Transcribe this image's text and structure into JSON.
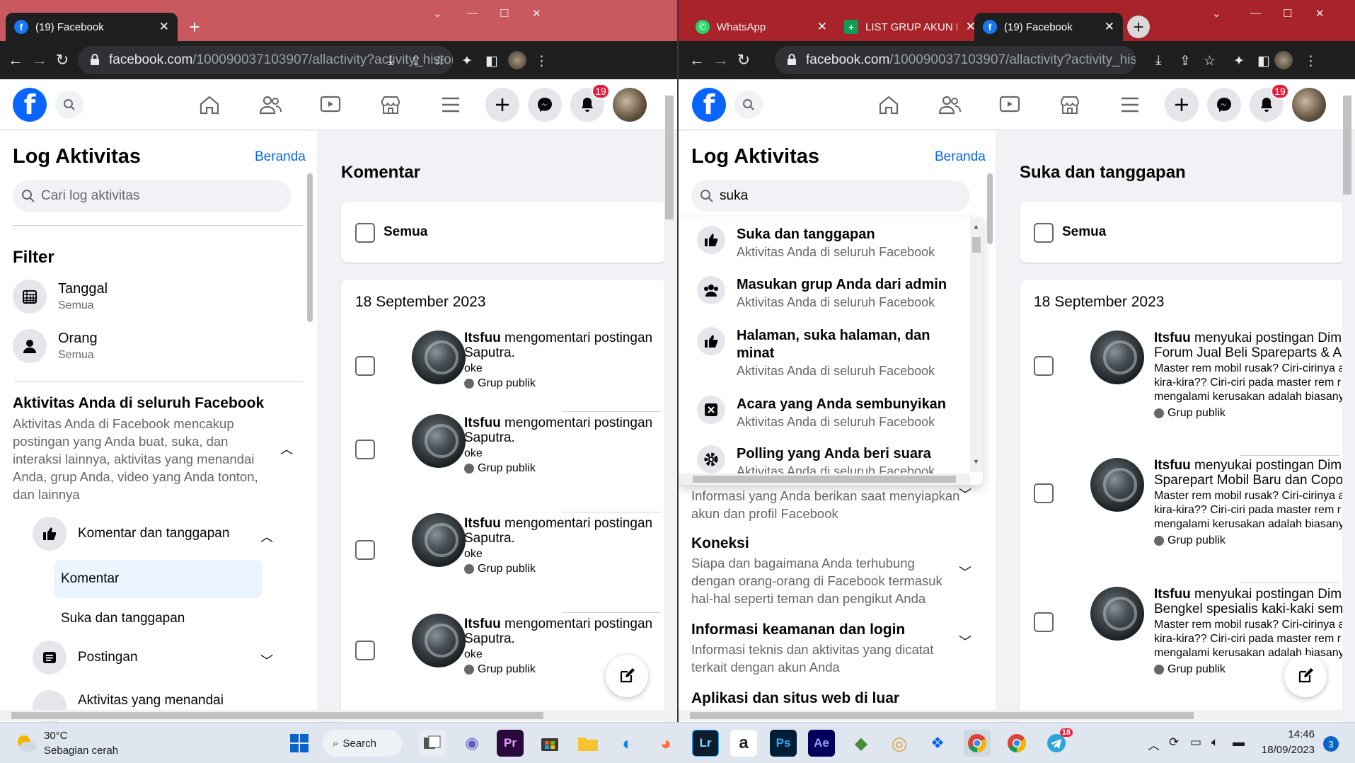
{
  "left": {
    "tabs": [
      {
        "title": "(19) Facebook",
        "favicon": "facebook-icon"
      }
    ],
    "url": {
      "host": "facebook.com",
      "path": "/100090037103907/allactivity?activity_history..."
    },
    "notification_count": "19",
    "sidebar": {
      "title": "Log Aktivitas",
      "home_link": "Beranda",
      "search_placeholder": "Cari log aktivitas",
      "filter_heading": "Filter",
      "filters": [
        {
          "label": "Tanggal",
          "value": "Semua",
          "icon": "calendar-icon"
        },
        {
          "label": "Orang",
          "value": "Semua",
          "icon": "person-icon"
        }
      ],
      "section_title": "Aktivitas Anda di seluruh Facebook",
      "section_desc": "Aktivitas Anda di Facebook mencakup postingan yang Anda buat, suka, dan interaksi lainnya, aktivitas yang menandai Anda, grup Anda, video yang Anda tonton, dan lainnya",
      "group": "Komentar dan tanggapan",
      "sub_selected": "Komentar",
      "sub_other": "Suka dan tanggapan",
      "next_group": "Postingan",
      "next_next_group": "Aktivitas yang menandai"
    },
    "main": {
      "title": "Komentar",
      "select_all": "Semua",
      "date": "18 September 2023",
      "items": [
        {
          "actor": "Itsfuu",
          "action": " mengomentari postingan",
          "line2": "Saputra.",
          "comment": "oke",
          "audience": "Grup publik"
        },
        {
          "actor": "Itsfuu",
          "action": " mengomentari postingan",
          "line2": "Saputra.",
          "comment": "oke",
          "audience": "Grup publik"
        },
        {
          "actor": "Itsfuu",
          "action": " mengomentari postingan",
          "line2": "Saputra.",
          "comment": "oke",
          "audience": "Grup publik"
        },
        {
          "actor": "Itsfuu",
          "action": " mengomentari postingan",
          "line2": "Saputra.",
          "comment": "oke",
          "audience": "Grup publik"
        }
      ]
    }
  },
  "right": {
    "tabs": [
      {
        "title": "WhatsApp",
        "favicon": "whatsapp-icon"
      },
      {
        "title": "LIST GRUP AKUN F",
        "favicon": "sheets-icon"
      },
      {
        "title": "(19) Facebook",
        "favicon": "facebook-icon"
      }
    ],
    "url": {
      "host": "facebook.com",
      "path": "/100090037103907/allactivity?activity_history..."
    },
    "notification_count": "19",
    "sidebar": {
      "title": "Log Aktivitas",
      "home_link": "Beranda",
      "search_value": "suka",
      "suggestions": [
        {
          "title": "Suka dan tanggapan",
          "sub": "Aktivitas Anda di seluruh Facebook",
          "icon": "thumbs-up-icon"
        },
        {
          "title": "Masukan grup Anda dari admin",
          "sub": "Aktivitas Anda di seluruh Facebook",
          "icon": "group-icon"
        },
        {
          "title": "Halaman, suka halaman, dan",
          "title2": "minat",
          "sub": "Aktivitas Anda di seluruh Facebook",
          "icon": "thumbs-up-icon"
        },
        {
          "title": "Acara yang Anda sembunyikan",
          "sub": "Aktivitas Anda di seluruh Facebook",
          "icon": "hidden-event-icon"
        },
        {
          "title": "Polling yang Anda beri suara",
          "sub": "Aktivitas Anda di seluruh Facebook",
          "icon": "gear-icon"
        }
      ],
      "below": [
        {
          "title": "",
          "desc": "Informasi yang Anda berikan saat menyiapkan akun dan profil Facebook"
        },
        {
          "title": "Koneksi",
          "desc": "Siapa dan bagaimana Anda terhubung dengan orang-orang di Facebook termasuk hal-hal seperti teman dan pengikut Anda"
        },
        {
          "title": "Informasi keamanan dan login",
          "desc": "Informasi teknis dan aktivitas yang dicatat terkait dengan akun Anda"
        },
        {
          "title": "Aplikasi dan situs web di luar",
          "desc": ""
        }
      ]
    },
    "main": {
      "title": "Suka dan tanggapan",
      "select_all": "Semua",
      "date": "18 September 2023",
      "items": [
        {
          "actor": "Itsfuu",
          "action": " menyukai postingan Dima",
          "line2": "Forum Jual Beli Spareparts & Al",
          "snippet": [
            "Master rem mobil rusak? Ciri-cirinya a",
            "kira-kira?? Ciri-ciri pada master rem r",
            "mengalami kerusakan adalah biasany"
          ],
          "audience": "Grup publik"
        },
        {
          "actor": "Itsfuu",
          "action": " menyukai postingan Dima",
          "line2": "Sparepart Mobil Baru dan Copo",
          "snippet": [
            "Master rem mobil rusak? Ciri-cirinya a",
            "kira-kira?? Ciri-ciri pada master rem r",
            "mengalami kerusakan adalah biasany"
          ],
          "audience": "Grup publik"
        },
        {
          "actor": "Itsfuu",
          "action": " menyukai postingan Dima",
          "line2": "Bengkel spesialis kaki-kaki sem",
          "snippet": [
            "Master rem mobil rusak? Ciri-cirinya a",
            "kira-kira?? Ciri-ciri pada master rem r",
            "mengalami kerusakan adalah biasany"
          ],
          "audience": "Grup publik"
        }
      ]
    }
  },
  "taskbar": {
    "weather_temp": "30°C",
    "weather_desc": "Sebagian cerah",
    "search_label": "Search",
    "time": "14:46",
    "date": "18/09/2023",
    "notif_count": "3",
    "telegram_badge": "18",
    "apps": [
      "start-icon",
      "search-button",
      "file-explorer-icon",
      "teams-icon",
      "premiere-icon",
      "store-icon",
      "folder-icon",
      "edge-icon",
      "firefox-icon",
      "lightroom-icon",
      "amazon-icon",
      "photoshop-icon",
      "after-effects-icon",
      "app-icon",
      "app-icon",
      "dropbox-icon",
      "chrome-icon",
      "chrome-icon",
      "telegram-icon"
    ],
    "app_labels": {
      "pr": "Pr",
      "lr": "Lr",
      "ps": "Ps",
      "ae": "Ae",
      "amazon": "a"
    }
  },
  "colors": {
    "fb_blue": "#0866ff",
    "tab_left": "#c9585f",
    "tab_right": "#a8232a",
    "badge": "#e41e3f"
  }
}
